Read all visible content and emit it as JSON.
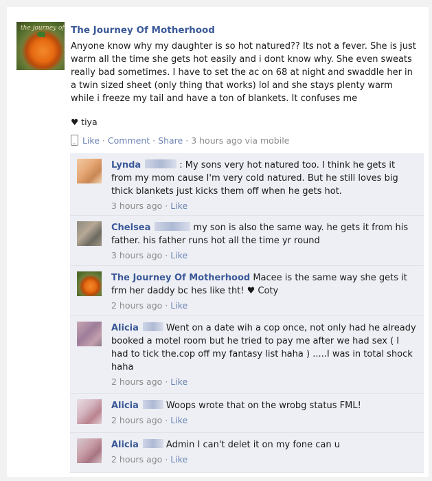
{
  "post": {
    "author": "The Journey Of Motherhood",
    "avatar_text": "the journey of",
    "text": "Anyone know why my daughter is so hot natured?? Its not a fever. She is just warm all the time she gets hot easily and i dont know why. She even sweats really bad sometimes. I have to set the ac on 68 at night and swaddle her in a twin sized sheet (only thing that works) lol and she stays plenty warm while i freeze my tail and have a ton of blankets. It confuses me",
    "signature": "♥ tiya",
    "actions": {
      "like": "Like",
      "comment": "Comment",
      "share": "Share",
      "time": "3 hours ago via mobile",
      "sep": "·"
    }
  },
  "comments": [
    {
      "author": "Lynda",
      "text": ": My sons very hot natured too. I think he gets it from my mom cause I'm very cold natured. But he still loves big thick blankets just kicks them off when he gets hot.",
      "time": "3 hours ago",
      "like": "Like"
    },
    {
      "author": "Chelsea",
      "text": "my son is also the same way. he gets it from his father. his father runs hot all the time yr round",
      "time": "3 hours ago",
      "like": "Like"
    },
    {
      "author": "The Journey Of Motherhood",
      "text": "Macee is the same way she gets it frm her daddy bc hes like tht! ♥ Coty",
      "time": "2 hours ago",
      "like": "Like"
    },
    {
      "author": "Alicia",
      "text": "Went on a date wih a cop once, not only had he already booked a motel room but he tried to pay me after we had sex ( I had to tick the.cop off my fantasy list haha ) .....I was in total shock haha",
      "time": "2 hours ago",
      "like": "Like"
    },
    {
      "author": "Alicia",
      "text": "Woops wrote that on the wrobg status FML!",
      "time": "2 hours ago",
      "like": "Like"
    },
    {
      "author": "Alicia",
      "text": "Admin I can't delet it on my fone can u",
      "time": "2 hours ago",
      "like": "Like"
    }
  ]
}
